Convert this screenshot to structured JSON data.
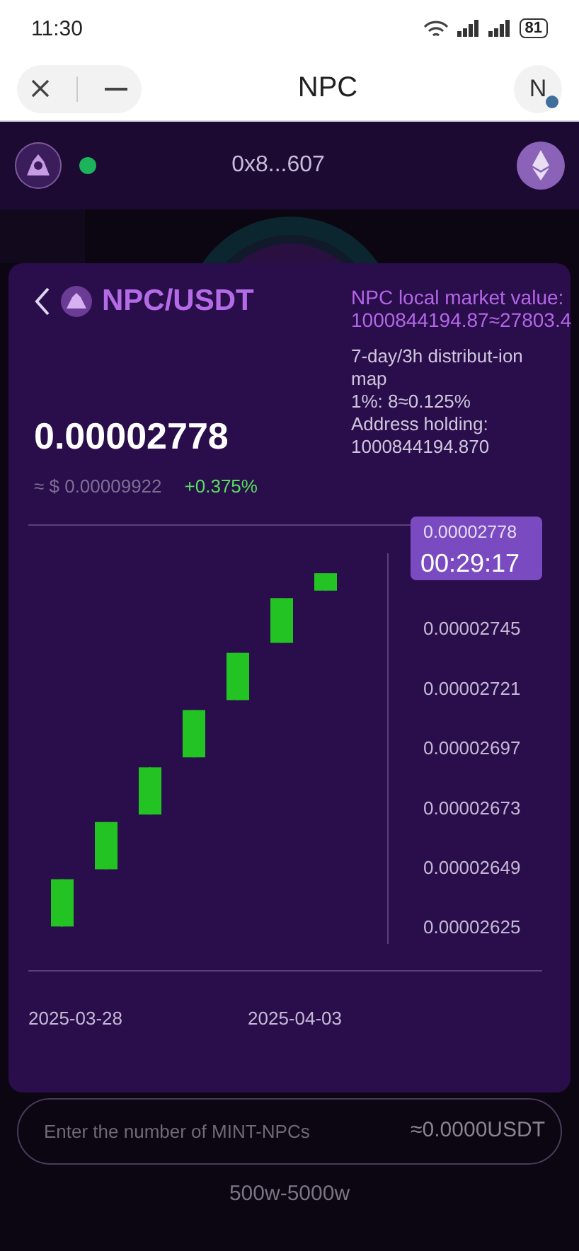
{
  "status_bar": {
    "time": "11:30",
    "battery": "81"
  },
  "header": {
    "title": "NPC",
    "avatar_letter": "N"
  },
  "wallet_bar": {
    "address": "0x8...607",
    "connected": true
  },
  "card": {
    "pair": "NPC/USDT",
    "price": "0.00002778",
    "usd_price": "≈ $ 0.00009922",
    "change": "+0.375%",
    "market_value": "NPC local market value: 1000844194.87≈27803.4",
    "distribution": "7-day/3h distribut-ion map",
    "ratio": "1%:  8≈0.125%",
    "holding": "Address holding: 1000844194.870",
    "chart_data": {
      "type": "candlestick",
      "categories": [
        "2025-03-28",
        null,
        null,
        null,
        null,
        "2025-04-03",
        null
      ],
      "ylim": [
        2.618e-05,
        2.775e-05
      ],
      "series": [
        {
          "color": "#22c322",
          "ohlc": [
            [
              2.625e-05,
              2.644e-05,
              2.625e-05,
              2.644e-05
            ],
            [
              2.648e-05,
              2.667e-05,
              2.648e-05,
              2.667e-05
            ],
            [
              2.67e-05,
              2.689e-05,
              2.67e-05,
              2.689e-05
            ],
            [
              2.693e-05,
              2.712e-05,
              2.693e-05,
              2.712e-05
            ],
            [
              2.716e-05,
              2.735e-05,
              2.716e-05,
              2.735e-05
            ],
            [
              2.739e-05,
              2.757e-05,
              2.739e-05,
              2.757e-05
            ],
            [
              2.76e-05,
              2.767e-05,
              2.76e-05,
              2.767e-05
            ]
          ]
        }
      ],
      "yticks": [
        {
          "value": 2.745e-05,
          "label": "0.00002745"
        },
        {
          "value": 2.721e-05,
          "label": "0.00002721"
        },
        {
          "value": 2.697e-05,
          "label": "0.00002697"
        },
        {
          "value": 2.673e-05,
          "label": "0.00002673"
        },
        {
          "value": 2.649e-05,
          "label": "0.00002649"
        },
        {
          "value": 2.625e-05,
          "label": "0.00002625"
        }
      ],
      "annotations": [
        "0.00002778",
        "00:29:17"
      ]
    }
  },
  "mint": {
    "placeholder": "Enter the number of MINT-NPCs",
    "estimate": "≈0.0000USDT",
    "range": "500w-5000w"
  }
}
